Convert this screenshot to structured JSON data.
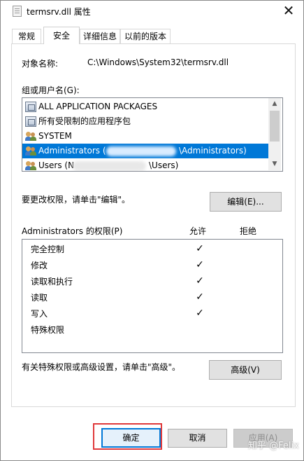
{
  "window": {
    "title": "termsrv.dll 属性",
    "close_glyph": "✕"
  },
  "tabs": [
    {
      "label": "常规",
      "active": false
    },
    {
      "label": "安全",
      "active": true
    },
    {
      "label": "详细信息",
      "active": false
    },
    {
      "label": "以前的版本",
      "active": false
    }
  ],
  "object": {
    "label": "对象名称:",
    "value": "C:\\Windows\\System32\\termsrv.dll"
  },
  "groups": {
    "label": "组或用户名(G):",
    "items": [
      {
        "name": "ALL APPLICATION PACKAGES",
        "icon": "package-icon",
        "selected": false
      },
      {
        "name": "所有受限制的应用程序包",
        "icon": "package-icon",
        "selected": false
      },
      {
        "name": "SYSTEM",
        "icon": "users-icon",
        "selected": false
      },
      {
        "name": "Administrators (\\Administrators)",
        "icon": "users-icon",
        "selected": true
      },
      {
        "name": "Users (N\\Users)",
        "icon": "users-icon",
        "selected": false
      }
    ],
    "selected_display": {
      "left": "Administrators (",
      "right": "\\Administrators)"
    },
    "users_display": {
      "left": "Users (N",
      "right": "\\Users)"
    }
  },
  "edit": {
    "hint": "要更改权限，请单击\"编辑\"。",
    "button": "编辑(E)..."
  },
  "permissions": {
    "title": "Administrators 的权限(P)",
    "allow_header": "允许",
    "deny_header": "拒绝",
    "rows": [
      {
        "name": "完全控制",
        "allow": true,
        "deny": false
      },
      {
        "name": "修改",
        "allow": true,
        "deny": false
      },
      {
        "name": "读取和执行",
        "allow": true,
        "deny": false
      },
      {
        "name": "读取",
        "allow": true,
        "deny": false
      },
      {
        "name": "写入",
        "allow": true,
        "deny": false
      },
      {
        "name": "特殊权限",
        "allow": false,
        "deny": false
      }
    ],
    "check_glyph": "✓"
  },
  "advanced": {
    "hint": "有关特殊权限或高级设置，请单击\"高级\"。",
    "button": "高级(V)"
  },
  "footer": {
    "ok": "确定",
    "cancel": "取消",
    "apply": "应用(A)",
    "watermark": "知乎 @Felix"
  },
  "colors": {
    "selection": "#0078d7",
    "highlight_border": "#e0393b"
  }
}
